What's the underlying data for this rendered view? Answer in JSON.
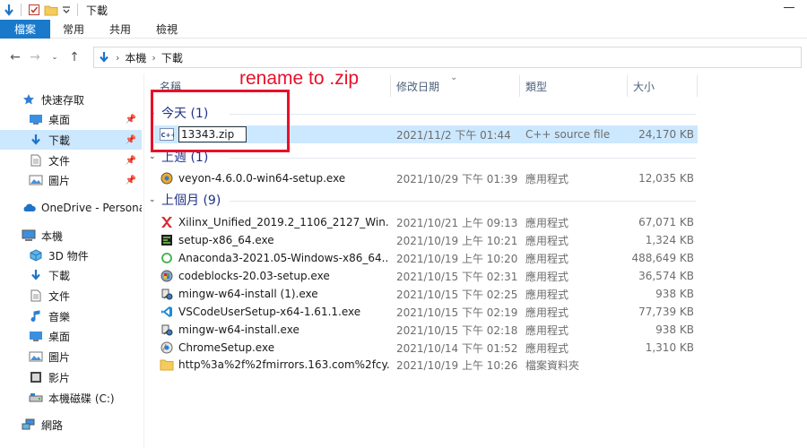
{
  "window": {
    "title": "下載"
  },
  "ribbon": {
    "tabs": [
      "檔案",
      "常用",
      "共用",
      "檢視"
    ]
  },
  "address": {
    "crumbs": [
      "本機",
      "下載"
    ]
  },
  "nav": {
    "quick_access": "快速存取",
    "items": [
      {
        "label": "桌面",
        "icon": "desktop-icon",
        "pinned": true
      },
      {
        "label": "下載",
        "icon": "download-icon",
        "pinned": true,
        "selected": true
      },
      {
        "label": "文件",
        "icon": "document-icon",
        "pinned": true
      },
      {
        "label": "圖片",
        "icon": "picture-icon",
        "pinned": true
      }
    ],
    "onedrive": "OneDrive - Personal",
    "this_pc": "本機",
    "pc_items": [
      {
        "label": "3D 物件",
        "icon": "3d-objects-icon"
      },
      {
        "label": "下載",
        "icon": "download-icon"
      },
      {
        "label": "文件",
        "icon": "document-icon"
      },
      {
        "label": "音樂",
        "icon": "music-icon"
      },
      {
        "label": "桌面",
        "icon": "desktop-icon"
      },
      {
        "label": "圖片",
        "icon": "picture-icon"
      },
      {
        "label": "影片",
        "icon": "video-icon"
      },
      {
        "label": "本機磁碟 (C:)",
        "icon": "disk-icon"
      }
    ],
    "network": "網路"
  },
  "columns": {
    "name": "名稱",
    "date": "修改日期",
    "type": "類型",
    "size": "大小"
  },
  "groups": [
    {
      "label": "今天 (1)",
      "files": [
        {
          "name": "13343.zip",
          "date": "2021/11/2 下午 01:44",
          "type": "C++ source file",
          "size": "24,170 KB",
          "icon": "cpp-file-icon",
          "renaming": true
        }
      ]
    },
    {
      "label": "上週 (1)",
      "files": [
        {
          "name": "veyon-4.6.0.0-win64-setup.exe",
          "date": "2021/10/29 下午 01:39",
          "type": "應用程式",
          "size": "12,035 KB",
          "icon": "veyon-app-icon"
        }
      ]
    },
    {
      "label": "上個月 (9)",
      "files": [
        {
          "name": "Xilinx_Unified_2019.2_1106_2127_Win...",
          "date": "2021/10/21 上午 09:13",
          "type": "應用程式",
          "size": "67,071 KB",
          "icon": "xilinx-app-icon"
        },
        {
          "name": "setup-x86_64.exe",
          "date": "2021/10/19 上午 10:21",
          "type": "應用程式",
          "size": "1,324 KB",
          "icon": "cygwin-app-icon"
        },
        {
          "name": "Anaconda3-2021.05-Windows-x86_64...",
          "date": "2021/10/19 上午 10:20",
          "type": "應用程式",
          "size": "488,649 KB",
          "icon": "anaconda-app-icon"
        },
        {
          "name": "codeblocks-20.03-setup.exe",
          "date": "2021/10/15 下午 02:31",
          "type": "應用程式",
          "size": "36,574 KB",
          "icon": "codeblocks-app-icon"
        },
        {
          "name": "mingw-w64-install (1).exe",
          "date": "2021/10/15 下午 02:25",
          "type": "應用程式",
          "size": "938 KB",
          "icon": "installer-app-icon"
        },
        {
          "name": "VSCodeUserSetup-x64-1.61.1.exe",
          "date": "2021/10/15 下午 02:19",
          "type": "應用程式",
          "size": "77,739 KB",
          "icon": "vscode-app-icon"
        },
        {
          "name": "mingw-w64-install.exe",
          "date": "2021/10/15 下午 02:18",
          "type": "應用程式",
          "size": "938 KB",
          "icon": "installer-app-icon"
        },
        {
          "name": "ChromeSetup.exe",
          "date": "2021/10/14 下午 01:52",
          "type": "應用程式",
          "size": "1,310 KB",
          "icon": "chrome-app-icon"
        },
        {
          "name": "http%3a%2f%2fmirrors.163.com%2fcy...",
          "date": "2021/10/19 上午 10:26",
          "type": "檔案資料夾",
          "size": "",
          "icon": "folder-icon"
        }
      ]
    }
  ],
  "annotation": {
    "text": "rename to .zip",
    "color": "#e8102a"
  },
  "colors": {
    "accent": "#1979ca",
    "selection": "#cce8ff",
    "group_text": "#1e3287"
  }
}
